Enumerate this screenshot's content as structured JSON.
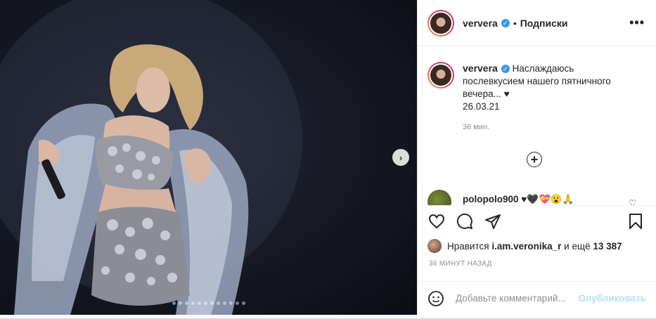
{
  "post": {
    "username": "ververa",
    "follow_label": "Подписки",
    "more_label": "•••",
    "caption_text": "Наслаждаюсь послевкусием нашего пятничного вечера... ♥",
    "caption_date": "26.03.21",
    "caption_time": "36 мин.",
    "load_more": "+"
  },
  "comments": [
    {
      "username": "polopolo900",
      "text": "♥🖤💝😮🙏"
    }
  ],
  "likes": {
    "prefix": "Нравится",
    "user": "i.am.veronika_r",
    "middle": "и ещё",
    "count": "13 387"
  },
  "time_ago": "36 МИНУТ НАЗАД",
  "add_comment": {
    "placeholder": "Добавьте комментарий...",
    "publish": "Опубликовать"
  },
  "carousel": {
    "total": 12,
    "active": 0
  },
  "colors": {
    "verified": "#3897f0",
    "publish_disabled": "#b2dffc",
    "story_ring": "#e4405f"
  },
  "icons": [
    "heart-icon",
    "comment-icon",
    "share-icon",
    "bookmark-icon",
    "emoji-icon",
    "chevron-right-icon"
  ]
}
